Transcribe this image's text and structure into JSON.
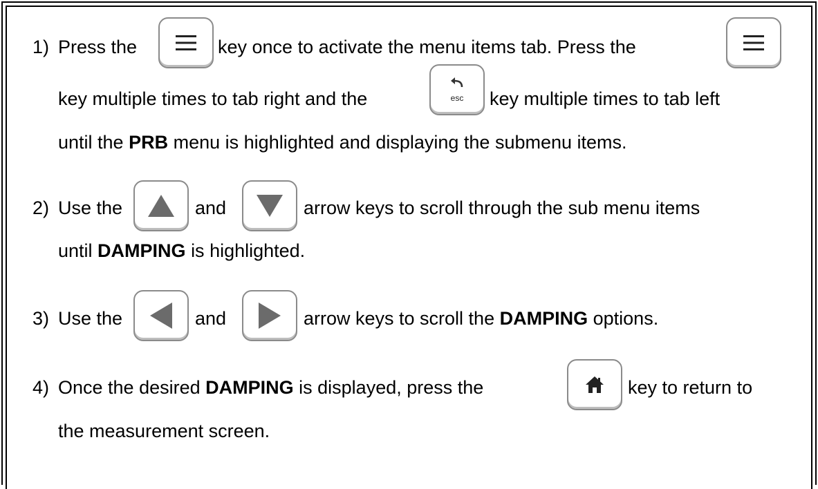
{
  "steps": [
    {
      "num": "1)",
      "l1_a": "Press the",
      "l1_b": "key once to activate the menu items tab.  Press the",
      "l2_a": "key multiple times to tab right and the",
      "l2_b": "key multiple times to tab left",
      "l3_a": "until the",
      "l3_bold": "PRB",
      "l3_b": "menu is highlighted and displaying the submenu items."
    },
    {
      "num": "2)",
      "l1_a": "Use the",
      "l1_and": "and",
      "l1_b": "arrow keys to scroll through the sub menu items",
      "l2_a": "until",
      "l2_bold": "DAMPING",
      "l2_b": "is highlighted."
    },
    {
      "num": "3)",
      "l1_a": "Use the",
      "l1_and": "and",
      "l1_b": "arrow keys to scroll the",
      "l1_bold": "DAMPING",
      "l1_c": "options."
    },
    {
      "num": "4)",
      "l1_a": "Once the desired",
      "l1_bold": "DAMPING",
      "l1_b": "is displayed, press the",
      "l1_c": "key to return to",
      "l2": "the measurement screen."
    }
  ],
  "keys": {
    "menu": "menu-icon",
    "esc": "esc",
    "esc_icon": "back-arrow-icon",
    "up": "up-arrow-icon",
    "down": "down-arrow-icon",
    "left": "left-arrow-icon",
    "right": "right-arrow-icon",
    "home": "home-icon"
  },
  "colors": {
    "key_border": "#8a8a8a",
    "arrow_fill": "#6b6b6b"
  }
}
